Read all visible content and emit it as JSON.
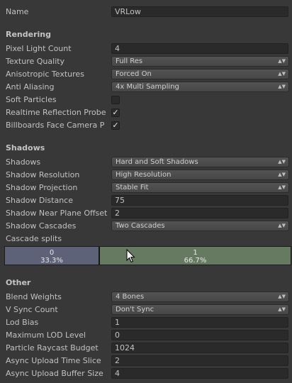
{
  "name": {
    "label": "Name",
    "value": "VRLow"
  },
  "rendering": {
    "title": "Rendering",
    "pixel_light_count": {
      "label": "Pixel Light Count",
      "value": "4"
    },
    "texture_quality": {
      "label": "Texture Quality",
      "value": "Full Res"
    },
    "anisotropic_textures": {
      "label": "Anisotropic Textures",
      "value": "Forced On"
    },
    "anti_aliasing": {
      "label": "Anti Aliasing",
      "value": "4x Multi Sampling"
    },
    "soft_particles": {
      "label": "Soft Particles",
      "checked": false
    },
    "realtime_reflection_probes": {
      "label": "Realtime Reflection Probe",
      "checked": true
    },
    "billboards_face_camera": {
      "label": "Billboards Face Camera P",
      "checked": true
    }
  },
  "shadows": {
    "title": "Shadows",
    "shadows": {
      "label": "Shadows",
      "value": "Hard and Soft Shadows"
    },
    "shadow_resolution": {
      "label": "Shadow Resolution",
      "value": "High Resolution"
    },
    "shadow_projection": {
      "label": "Shadow Projection",
      "value": "Stable Fit"
    },
    "shadow_distance": {
      "label": "Shadow Distance",
      "value": "75"
    },
    "shadow_near_plane_offset": {
      "label": "Shadow Near Plane Offset",
      "value": "2"
    },
    "shadow_cascades": {
      "label": "Shadow Cascades",
      "value": "Two Cascades"
    },
    "cascade_splits": {
      "label": "Cascade splits",
      "splits": [
        {
          "index": "0",
          "percent": "33.3%"
        },
        {
          "index": "1",
          "percent": "66.7%"
        }
      ]
    }
  },
  "other": {
    "title": "Other",
    "blend_weights": {
      "label": "Blend Weights",
      "value": "4 Bones"
    },
    "v_sync_count": {
      "label": "V Sync Count",
      "value": "Don't Sync"
    },
    "lod_bias": {
      "label": "Lod Bias",
      "value": "1"
    },
    "maximum_lod_level": {
      "label": "Maximum LOD Level",
      "value": "0"
    },
    "particle_raycast_budget": {
      "label": "Particle Raycast Budget",
      "value": "1024"
    },
    "async_upload_time_slice": {
      "label": "Async Upload Time Slice",
      "value": "2"
    },
    "async_upload_buffer_size": {
      "label": "Async Upload Buffer Size",
      "value": "4"
    }
  },
  "icons": {
    "dropdown_arrow": "updown-arrow-icon",
    "check": "checkmark-icon",
    "cursor": "mouse-pointer-icon"
  },
  "colors": {
    "background": "#383838",
    "cascade_0": "#5e6279",
    "cascade_1": "#667a62"
  }
}
